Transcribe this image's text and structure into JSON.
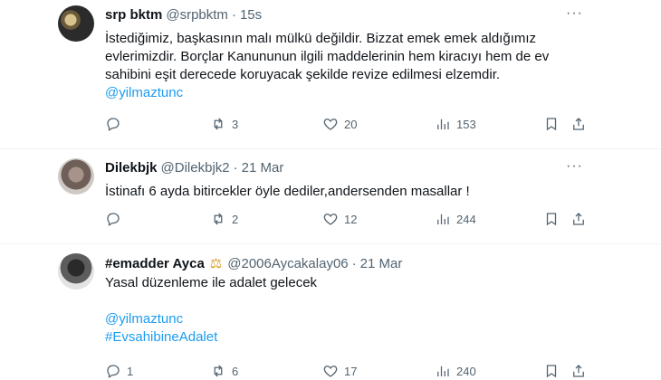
{
  "tweets": [
    {
      "name": "srp bktm",
      "handle": "@srpbktm",
      "time": "15s",
      "lines": [
        "İstediğimiz, başkasının malı mülkü değildir. Bizzat emek emek aldığımız",
        "evlerimizdir. Borçlar Kanununun ilgili maddelerinin hem kiracıyı hem de ev",
        "sahibini eşit derecede koruyacak şekilde revize edilmesi elzemdir."
      ],
      "mention": "@yilmaztunc",
      "replies": "",
      "retweets": "3",
      "likes": "20",
      "views": "153"
    },
    {
      "name": "Dilekbjk",
      "handle": "@Dilekbjk2",
      "time": "21 Mar",
      "lines": [
        "İstinafı 6 ayda bitircekler öyle dediler,andersenden masallar !"
      ],
      "replies": "",
      "retweets": "2",
      "likes": "12",
      "views": "244"
    },
    {
      "name": "#emadder Ayca",
      "badge_icon": "scales-icon",
      "handle": "@2006Aycakalay06",
      "time": "21 Mar",
      "lines": [
        "Yasal düzenleme ile adalet gelecek"
      ],
      "mention": "@yilmaztunc",
      "hashtag": "#EvsahibineAdalet",
      "replies": "1",
      "retweets": "6",
      "likes": "17",
      "views": "240"
    }
  ],
  "ui": {
    "dot": "·",
    "more": "···"
  },
  "colors": {
    "accent": "#1d9bf0",
    "secondary_text": "#536471",
    "text": "#0f1419",
    "divider": "#eff3f4"
  }
}
